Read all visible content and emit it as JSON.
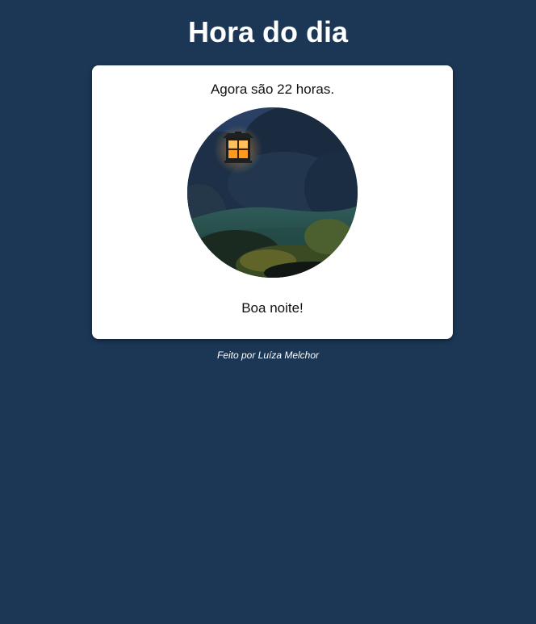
{
  "theme": {
    "background": "#1b3755",
    "card_background": "#ffffff",
    "title_color": "#ffffff",
    "footer_color": "#ffffff"
  },
  "header": {
    "title": "Hora do dia"
  },
  "card": {
    "time_text": "Agora são 22 horas.",
    "greeting": "Boa noite!",
    "image_icon": "night-garden-lantern-photo"
  },
  "footer": {
    "credit": "Feito por Luíza Melchor"
  }
}
